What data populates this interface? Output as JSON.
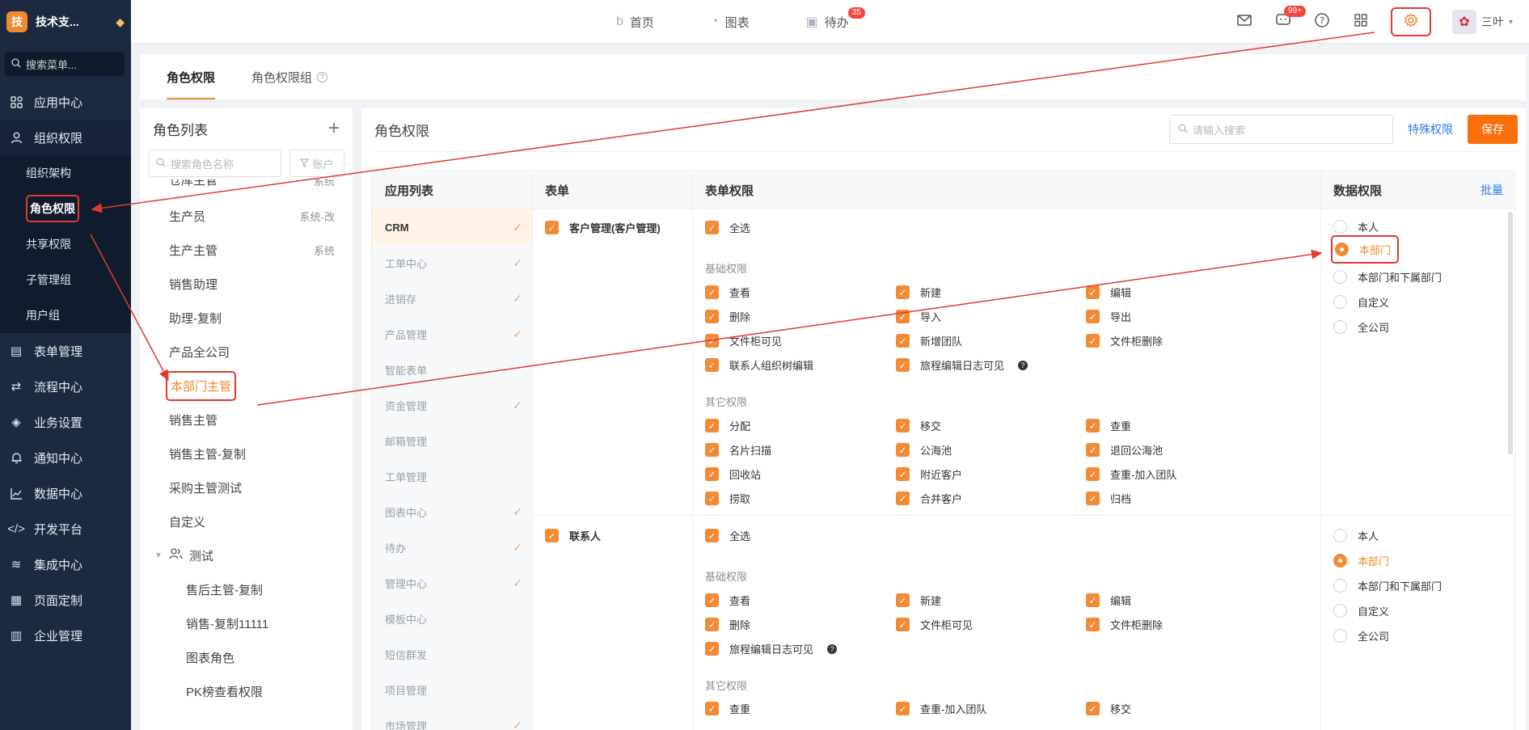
{
  "sidebar": {
    "brand_logo": "技",
    "brand_name": "技术支...",
    "search_placeholder": "搜索菜单...",
    "menu": [
      {
        "label": "应用中心",
        "icon": "grid-icon"
      },
      {
        "label": "组织权限",
        "icon": "user-icon"
      },
      {
        "label": "表单管理",
        "icon": "form-icon"
      },
      {
        "label": "流程中心",
        "icon": "flow-icon"
      },
      {
        "label": "业务设置",
        "icon": "cube-icon"
      },
      {
        "label": "通知中心",
        "icon": "bell-icon"
      },
      {
        "label": "数据中心",
        "icon": "chart-icon"
      },
      {
        "label": "开发平台",
        "icon": "code-icon"
      },
      {
        "label": "集成中心",
        "icon": "layers-icon"
      },
      {
        "label": "页面定制",
        "icon": "layout-icon"
      },
      {
        "label": "企业管理",
        "icon": "building-icon"
      }
    ],
    "submenu": [
      "组织架构",
      "角色权限",
      "共享权限",
      "子管理组",
      "用户组"
    ]
  },
  "topbar": {
    "nav": [
      {
        "label": "首页",
        "icon": "home-icon"
      },
      {
        "label": "图表",
        "icon": "pie-icon"
      },
      {
        "label": "待办",
        "icon": "calendar-icon",
        "badge": "35"
      }
    ],
    "message_badge": "99+",
    "user_name": "三叶"
  },
  "tabs": {
    "role_perm": "角色权限",
    "role_group": "角色权限组",
    "help": "?"
  },
  "role_panel": {
    "title": "角色列表",
    "add": "+",
    "search_placeholder": "搜索角色名称",
    "filter_label": "账户",
    "roles": [
      {
        "name": "仓库主管",
        "tag": "系统"
      },
      {
        "name": "生产员",
        "tag": "系统-改"
      },
      {
        "name": "生产主管",
        "tag": "系统"
      },
      {
        "name": "销售助理",
        "tag": ""
      },
      {
        "name": "助理-复制",
        "tag": ""
      },
      {
        "name": "产品全公司",
        "tag": ""
      },
      {
        "name": "本部门主管",
        "tag": ""
      },
      {
        "name": "销售主管",
        "tag": ""
      },
      {
        "name": "销售主管-复制",
        "tag": ""
      },
      {
        "name": "采购主管测试",
        "tag": ""
      },
      {
        "name": "自定义",
        "tag": ""
      }
    ],
    "group_name": "测试",
    "group_roles": [
      "售后主管-复制",
      "销售-复制11111",
      "图表角色",
      "PK榜查看权限"
    ]
  },
  "perm_panel": {
    "title": "角色权限",
    "search_placeholder": "请输入搜索",
    "special": "特殊权限",
    "save": "保存",
    "headers": {
      "apps": "应用列表",
      "form": "表单",
      "form_perm": "表单权限",
      "data_perm": "数据权限",
      "batch": "批量"
    },
    "apps": [
      {
        "name": "CRM",
        "checked": true
      },
      {
        "name": "工单中心",
        "checked": true
      },
      {
        "name": "进销存",
        "checked": true
      },
      {
        "name": "产品管理",
        "checked": true
      },
      {
        "name": "智能表单",
        "checked": false
      },
      {
        "name": "资金管理",
        "checked": true
      },
      {
        "name": "邮箱管理",
        "checked": false
      },
      {
        "name": "工单管理",
        "checked": false
      },
      {
        "name": "图表中心",
        "checked": true
      },
      {
        "name": "待办",
        "checked": true
      },
      {
        "name": "管理中心",
        "checked": true
      },
      {
        "name": "模板中心",
        "checked": false
      },
      {
        "name": "短信群发",
        "checked": false
      },
      {
        "name": "项目管理",
        "checked": false
      },
      {
        "name": "市场管理",
        "checked": true
      }
    ],
    "check_mark": "✓",
    "forms": [
      {
        "name": "客户管理(客户管理)",
        "select_all": "全选",
        "basic_title": "基础权限",
        "basic": [
          "查看",
          "新建",
          "编辑",
          "删除",
          "导入",
          "导出",
          "文件柜可见",
          "新增团队",
          "文件柜删除",
          "联系人组织树编辑",
          "旅程编辑日志可见"
        ],
        "other_title": "其它权限",
        "other": [
          "分配",
          "移交",
          "查重",
          "名片扫描",
          "公海池",
          "退回公海池",
          "回收站",
          "附近客户",
          "查重-加入团队",
          "捞取",
          "合并客户",
          "归档"
        ]
      },
      {
        "name": "联系人",
        "select_all": "全选",
        "basic_title": "基础权限",
        "basic": [
          "查看",
          "新建",
          "编辑",
          "删除",
          "文件柜可见",
          "文件柜删除",
          "旅程编辑日志可见"
        ],
        "other_title": "其它权限",
        "other": [
          "查重",
          "查重-加入团队",
          "移交"
        ]
      }
    ],
    "data_options": [
      "本人",
      "本部门",
      "本部门和下属部门",
      "自定义",
      "全公司"
    ],
    "selected_option": "本部门"
  },
  "colors": {
    "accent": "#f08a2c",
    "annotation": "#e13a2f",
    "sidebar": "#1b2a41",
    "link": "#2d7be5"
  }
}
